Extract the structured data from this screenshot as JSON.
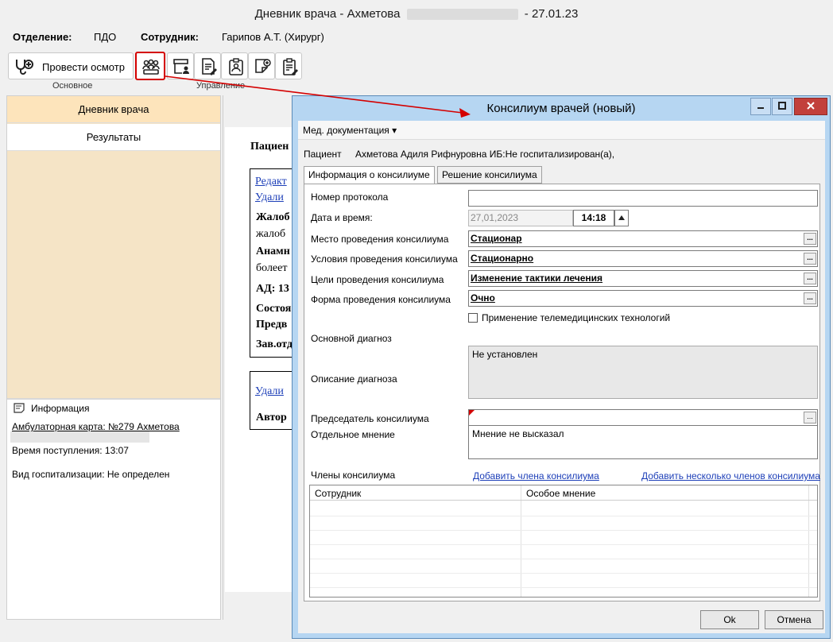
{
  "window": {
    "title_prefix": "Дневник врача - Ахметова",
    "title_suffix": "- 27.01.23"
  },
  "header": {
    "department_label": "Отделение:",
    "department_value": "ПДО",
    "employee_label": "Сотрудник:",
    "employee_value": "Гарипов А.Т. (Хирург)"
  },
  "ribbon": {
    "examine_label": "Провести осмотр",
    "group_main": "Основное",
    "group_manage": "Управление"
  },
  "left_nav": {
    "active": "Дневник врача",
    "other": "Результаты"
  },
  "info": {
    "title": "Информация",
    "card": "Амбулаторная карта: №279 Ахметова",
    "arrival": "Время поступления: 13:07",
    "hosp_type": "Вид госпитализации: Не определен"
  },
  "document": {
    "patient": "Пациен",
    "edit": "Редакт",
    "delete1": "Удали",
    "complaints": "Жалоб",
    "complaints_text": "жалоб",
    "anamnesis": "Анамн",
    "anamnesis_text": "болеет",
    "ad": "АД: 13",
    "state": "Состоя",
    "prelim": "Предв",
    "head": "Зав.отд",
    "delete2": "Удали",
    "author": "Автор"
  },
  "dialog": {
    "title": "Консилиум врачей (новый)",
    "menu": "Мед. документация",
    "patient_label": "Пациент",
    "patient_value": "Ахметова Адиля Рифнуровна ИБ:Не госпитализирован(а),",
    "tabs": [
      "Информация о консилиуме",
      "Решение консилиума"
    ],
    "fields": {
      "protocol_label": "Номер протокола",
      "protocol_value": "",
      "datetime_label": "Дата и время:",
      "date_value": "27,01,2023",
      "time_value": "14:18",
      "place_label": "Место проведения консилиума",
      "place_value": "Стационар",
      "conditions_label": "Условия проведения консилиума",
      "conditions_value": "Стационарно",
      "goals_label": "Цели проведения консилиума",
      "goals_value": "Изменение тактики лечения",
      "form_label": "Форма проведения консилиума",
      "form_value": "Очно",
      "telemed_label": "Применение телемедицинских технологий",
      "main_diag_label": "Основной диагноз",
      "diag_desc_label": "Описание диагноза",
      "diag_desc_value": "Не установлен",
      "chairman_label": "Председатель консилиума",
      "opinion_label": "Отдельное мнение",
      "opinion_value": "Мнение не высказал",
      "members_label": "Члены консилиума",
      "add_member": "Добавить члена консилиума",
      "add_members": "Добавить несколько членов консилиума"
    },
    "grid_headers": [
      "Сотрудник",
      "Особое мнение"
    ],
    "ok": "Ok",
    "cancel": "Отмена"
  },
  "colors": {
    "accent_red": "#d40000",
    "dialog_frame": "#b6d6f2",
    "nav_active": "#fde4bb",
    "link": "#1d3fb8"
  }
}
